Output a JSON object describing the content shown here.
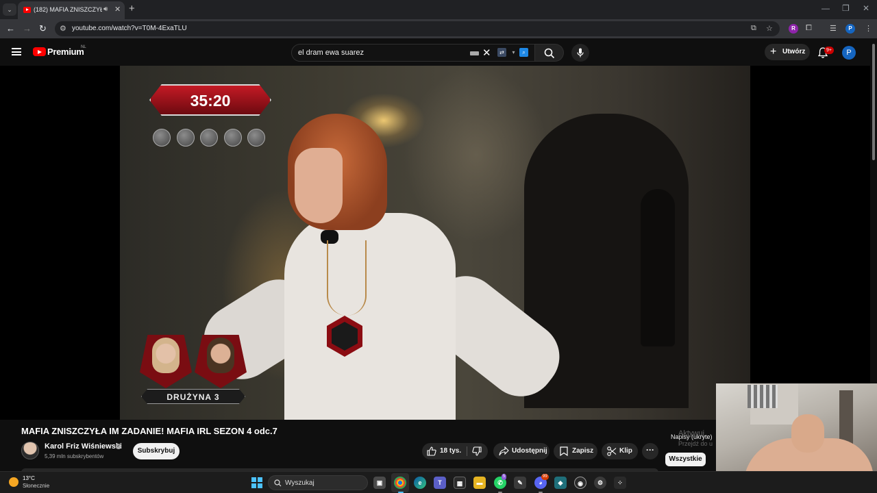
{
  "browser": {
    "tab_title": "(182) MAFIA ZNISZCZYŁA I",
    "url": "youtube.com/watch?v=T0M-4ExaTLU",
    "profile_letter": "P",
    "extension_letter": "R"
  },
  "header": {
    "logo_text": "Premium",
    "region": "NL",
    "search_query": "el dram ewa suarez",
    "create_label": "Utwórz",
    "notifications_badge": "9+",
    "avatar_letter": "P"
  },
  "player": {
    "timer": "35:20",
    "team_label": "DRUŻYNA 3",
    "coins_count": 5
  },
  "video": {
    "title": "MAFIA ZNISZCZYŁA IM ZADANIE! MAFIA IRL SEZON 4 odc.7",
    "channel_name": "Karol Friz Wiśniewski",
    "subscribers": "5,39 mln subskrybentów",
    "subscribe_label": "Subskrybuj",
    "likes": "18 tys.",
    "share_label": "Udostępnij",
    "save_label": "Zapisz",
    "clip_label": "Klip",
    "more_label": "···"
  },
  "side": {
    "captions_tip": "Napisy (ukryte)",
    "activate_line1": "Aktywuj",
    "activate_line2": "Przejdź do u",
    "chip_all": "Wszystkie"
  },
  "taskbar": {
    "weather_temp": "13°C",
    "weather_desc": "Słonecznie",
    "search_label": "Wyszukaj",
    "badge_a": "5",
    "badge_b": "99"
  },
  "colors": {
    "youtube_red": "#ff0000",
    "timer_red": "#c41a25",
    "accent_blue": "#4cc2ff"
  }
}
